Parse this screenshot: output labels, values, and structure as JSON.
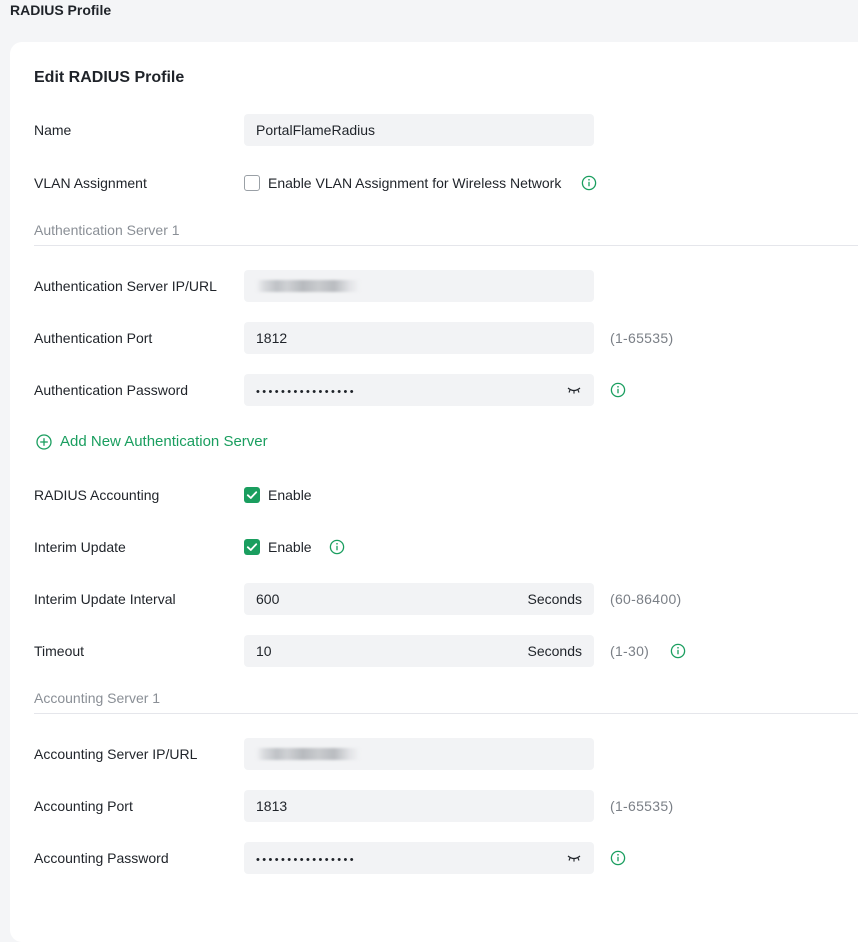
{
  "page_title": "RADIUS Profile",
  "form": {
    "title": "Edit RADIUS Profile",
    "name": {
      "label": "Name",
      "value": "PortalFlameRadius"
    },
    "vlan_assignment": {
      "label": "VLAN Assignment",
      "checkbox_label": "Enable VLAN Assignment for Wireless Network",
      "checked": false
    },
    "auth_section_title": "Authentication Server 1",
    "auth_server_ip": {
      "label": "Authentication Server IP/URL",
      "value": ""
    },
    "auth_port": {
      "label": "Authentication Port",
      "value": "1812",
      "range": "(1-65535)"
    },
    "auth_password": {
      "label": "Authentication Password",
      "value": "••••••••••••••••"
    },
    "add_auth_server_label": "Add New Authentication Server",
    "radius_accounting": {
      "label": "RADIUS Accounting",
      "checkbox_label": "Enable",
      "checked": true
    },
    "interim_update": {
      "label": "Interim Update",
      "checkbox_label": "Enable",
      "checked": true
    },
    "interim_update_interval": {
      "label": "Interim Update Interval",
      "value": "600",
      "unit": "Seconds",
      "range": "(60-86400)"
    },
    "timeout": {
      "label": "Timeout",
      "value": "10",
      "unit": "Seconds",
      "range": "(1-30)"
    },
    "acct_section_title": "Accounting Server 1",
    "acct_server_ip": {
      "label": "Accounting Server IP/URL",
      "value": ""
    },
    "acct_port": {
      "label": "Accounting Port",
      "value": "1813",
      "range": "(1-65535)"
    },
    "acct_password": {
      "label": "Accounting Password",
      "value": "••••••••••••••••"
    }
  },
  "colors": {
    "accent": "#1a9e5f",
    "field_bg": "#f2f3f5",
    "muted_text": "#8a8f96"
  },
  "icons": {
    "info": "info-circle-icon",
    "password_toggle": "eye-closed-icon",
    "add": "plus-circle-icon",
    "check": "checkmark-icon"
  }
}
